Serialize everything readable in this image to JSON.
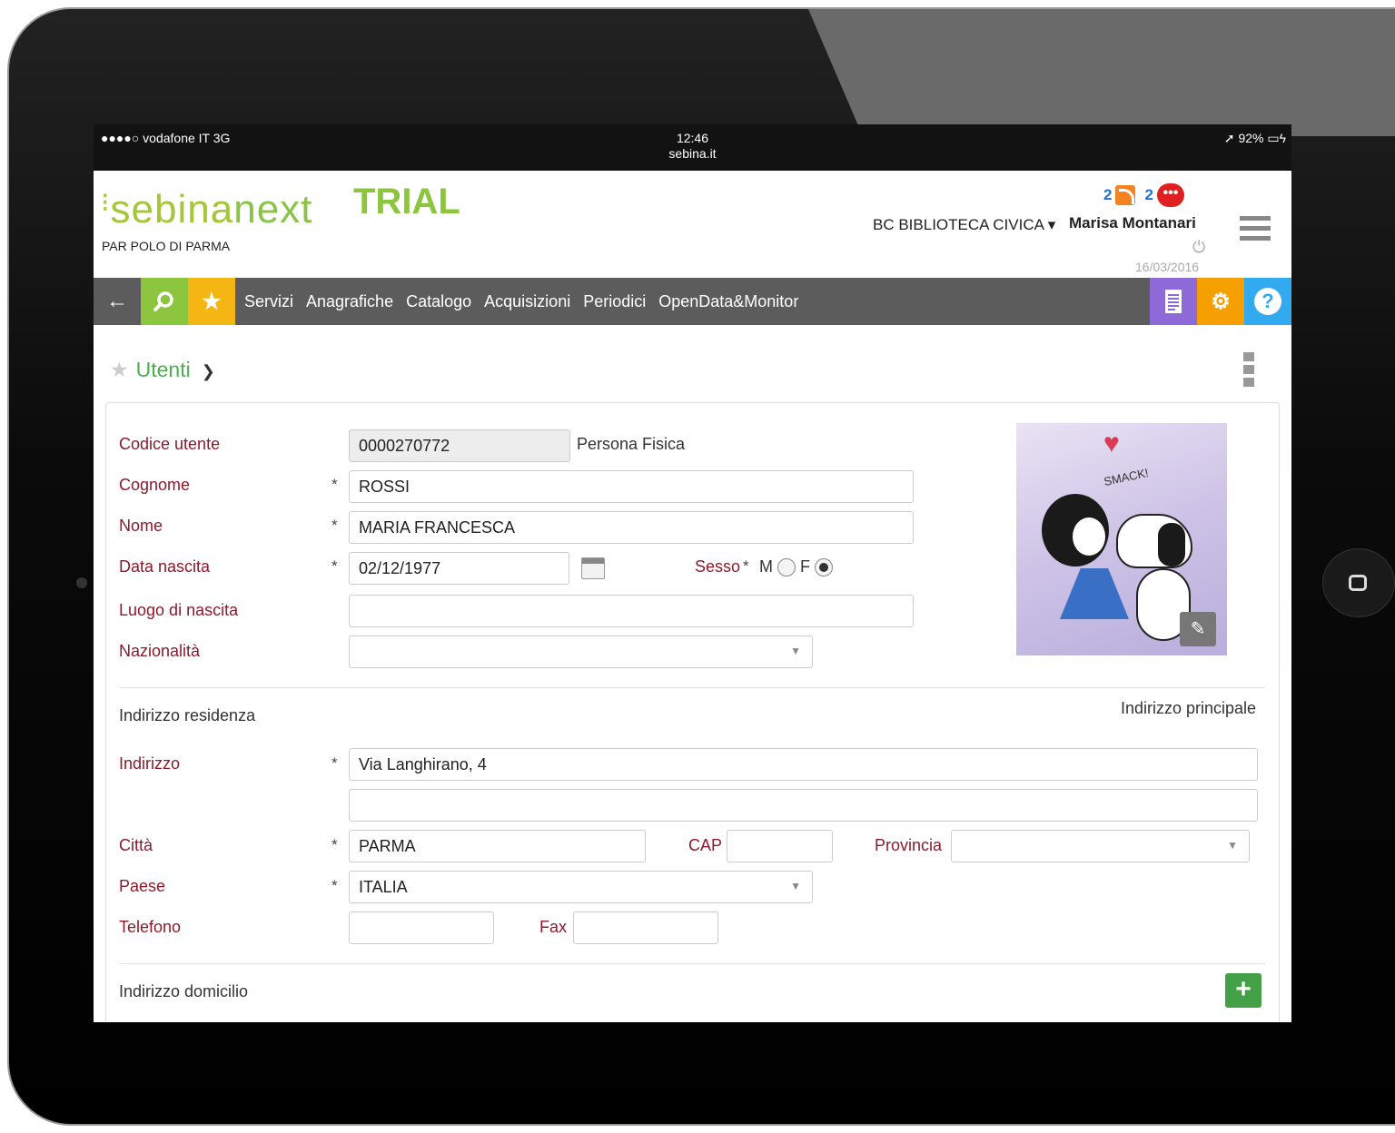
{
  "status_bar": {
    "carrier": "●●●●○ vodafone IT  3G",
    "time": "12:46",
    "domain": "sebina.it",
    "battery": "➚ 92% ▭ϟ"
  },
  "header": {
    "logo_prefix": "sebina",
    "logo_suffix": "next",
    "trial": "TRIAL",
    "polo": "PAR POLO DI PARMA",
    "rss_count": "2",
    "msg_count": "2",
    "library": "BC BIBLIOTECA CIVICA ▾",
    "user": "Marisa Montanari",
    "date": "16/03/2016"
  },
  "navbar": {
    "menu": [
      "Servizi",
      "Anagrafiche",
      "Catalogo",
      "Acquisizioni",
      "Periodici",
      "OpenData&Monitor"
    ]
  },
  "page": {
    "title": "Utenti"
  },
  "form": {
    "codice_label": "Codice utente",
    "codice_value": "0000270772",
    "tipo": "Persona Fisica",
    "cognome_label": "Cognome",
    "cognome_value": "ROSSI",
    "nome_label": "Nome",
    "nome_value": "MARIA FRANCESCA",
    "data_label": "Data nascita",
    "data_value": "02/12/1977",
    "sesso_label": "Sesso",
    "sesso_m": "M",
    "sesso_f": "F",
    "sesso_selected": "F",
    "luogo_label": "Luogo di nascita",
    "luogo_value": "",
    "nazionalita_label": "Nazionalità",
    "nazionalita_value": "",
    "req_mark": "*",
    "residenza_title": "Indirizzo residenza",
    "principale": "Indirizzo principale",
    "indirizzo_label": "Indirizzo",
    "indirizzo_value": "Via Langhirano, 4",
    "indirizzo2_value": "",
    "citta_label": "Città",
    "citta_value": "PARMA",
    "cap_label": "CAP",
    "cap_value": "",
    "provincia_label": "Provincia",
    "provincia_value": "",
    "paese_label": "Paese",
    "paese_value": "ITALIA",
    "telefono_label": "Telefono",
    "telefono_value": "",
    "fax_label": "Fax",
    "fax_value": "",
    "domicilio_title": "Indirizzo domicilio"
  },
  "photo": {
    "caption": "SMACK!"
  },
  "colors": {
    "accent_green": "#8cc63f",
    "label_red": "#8b1a2b",
    "nav_gray": "#5c5c5c",
    "star_yellow": "#f5b614",
    "doc_purple": "#8e6ad8",
    "gear_orange": "#f5a000",
    "help_blue": "#31aaf0"
  }
}
